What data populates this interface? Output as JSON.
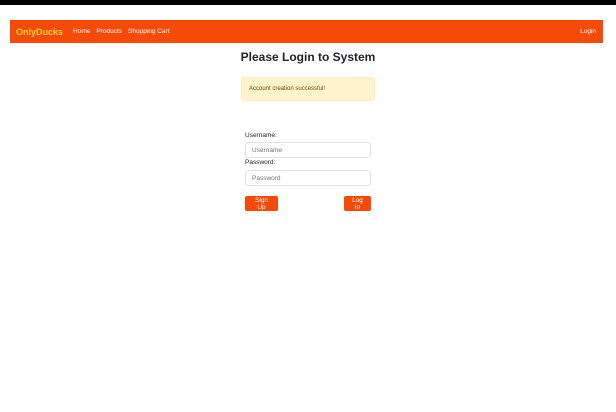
{
  "nav": {
    "brand": "OnlyDucks",
    "links": [
      "Home",
      "Products",
      "Shopping Cart"
    ],
    "login": "Login"
  },
  "page": {
    "title": "Please Login to System",
    "alert": "Account creation successful!"
  },
  "form": {
    "username_label": "Username:",
    "username_placeholder": "Username",
    "username_value": "",
    "password_label": "Password:",
    "password_placeholder": "Password",
    "password_value": "",
    "signup_label": "Sign Up",
    "login_label": "Log In"
  },
  "colors": {
    "primary": "#f74a06",
    "brand_text": "#ffd43b",
    "alert_bg": "#fff3cd"
  }
}
